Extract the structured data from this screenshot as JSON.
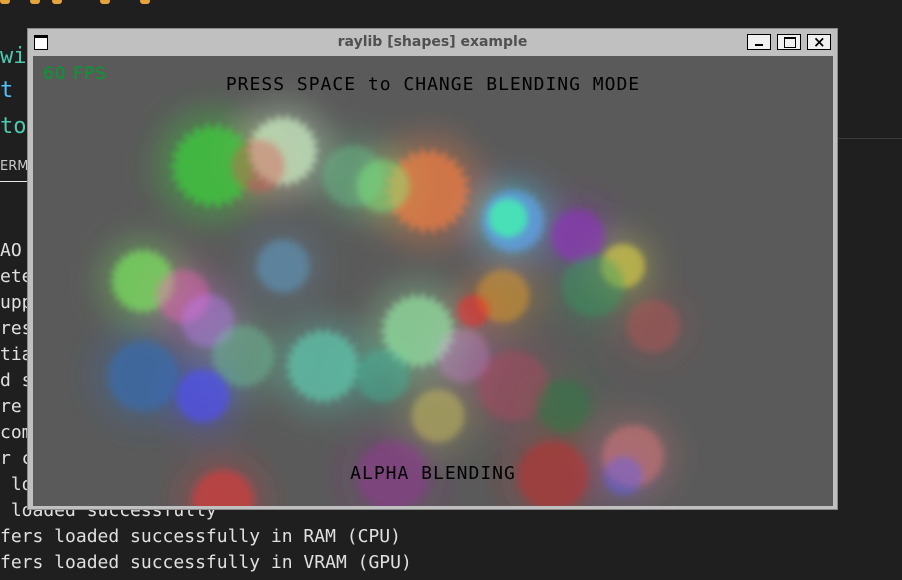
{
  "background": {
    "code_lines": [
      {
        "text": "wi",
        "color": "#4ec9b0"
      },
      {
        "text": "t",
        "color": "#4fc1ff"
      },
      {
        "text": "tor",
        "color": "#4ec9b0"
      }
    ],
    "panel_tab": "ERM",
    "terminal_lines": [
      "AO",
      "ete",
      "upp",
      "res",
      "tia",
      "d s",
      "re",
      "com",
      "r c",
      " lo",
      " loaded successfully",
      "fers loaded successfully in RAM (CPU)",
      "fers loaded successfully in VRAM (GPU)"
    ]
  },
  "window": {
    "title": "raylib [shapes] example",
    "minimize_glyph": "–",
    "maximize_glyph": "□",
    "close_glyph": "×",
    "fps_text": "60 FPS",
    "instruction": "PRESS SPACE to CHANGE BLENDING MODE",
    "blend_mode": "ALPHA BLENDING"
  },
  "colors": {
    "canvas_bg": "#5a5a5a",
    "fps_color": "#009e2f",
    "accent": "#4ec9b0"
  }
}
